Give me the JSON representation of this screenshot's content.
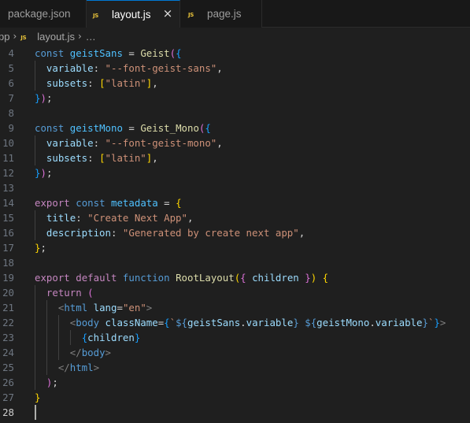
{
  "tabs": [
    {
      "label": "package.json",
      "active": false,
      "icon": "json-file-icon"
    },
    {
      "label": "layout.js",
      "active": true,
      "icon": "js-file-icon",
      "close": "×"
    },
    {
      "label": "page.js",
      "active": false,
      "icon": "js-file-icon"
    }
  ],
  "js_icon_text": "JS",
  "breadcrumb": {
    "folder": "pp",
    "file": "layout.js",
    "more": "…",
    "sep": "›"
  },
  "editor": {
    "current_line": "28",
    "lines": [
      {
        "n": "4",
        "tokens": [
          [
            "kw",
            "const"
          ],
          [
            "pn",
            " "
          ],
          [
            "const",
            "geistSans"
          ],
          [
            "pn",
            " = "
          ],
          [
            "fn",
            "Geist"
          ],
          [
            "p2",
            "("
          ],
          [
            "p3",
            "{"
          ]
        ]
      },
      {
        "n": "5",
        "tokens": [
          [
            "pn",
            "  "
          ],
          [
            "var",
            "variable"
          ],
          [
            "pn",
            ": "
          ],
          [
            "str",
            "\"--font-geist-sans\""
          ],
          [
            "pn",
            ","
          ]
        ]
      },
      {
        "n": "6",
        "tokens": [
          [
            "pn",
            "  "
          ],
          [
            "var",
            "subsets"
          ],
          [
            "pn",
            ": "
          ],
          [
            "p1",
            "["
          ],
          [
            "str",
            "\"latin\""
          ],
          [
            "p1",
            "]"
          ],
          [
            "pn",
            ","
          ]
        ]
      },
      {
        "n": "7",
        "tokens": [
          [
            "p3",
            "}"
          ],
          [
            "p2",
            ")"
          ],
          [
            "pn",
            ";"
          ]
        ]
      },
      {
        "n": "8",
        "tokens": []
      },
      {
        "n": "9",
        "tokens": [
          [
            "kw",
            "const"
          ],
          [
            "pn",
            " "
          ],
          [
            "const",
            "geistMono"
          ],
          [
            "pn",
            " = "
          ],
          [
            "fn",
            "Geist_Mono"
          ],
          [
            "p2",
            "("
          ],
          [
            "p3",
            "{"
          ]
        ]
      },
      {
        "n": "10",
        "tokens": [
          [
            "pn",
            "  "
          ],
          [
            "var",
            "variable"
          ],
          [
            "pn",
            ": "
          ],
          [
            "str",
            "\"--font-geist-mono\""
          ],
          [
            "pn",
            ","
          ]
        ]
      },
      {
        "n": "11",
        "tokens": [
          [
            "pn",
            "  "
          ],
          [
            "var",
            "subsets"
          ],
          [
            "pn",
            ": "
          ],
          [
            "p1",
            "["
          ],
          [
            "str",
            "\"latin\""
          ],
          [
            "p1",
            "]"
          ],
          [
            "pn",
            ","
          ]
        ]
      },
      {
        "n": "12",
        "tokens": [
          [
            "p3",
            "}"
          ],
          [
            "p2",
            ")"
          ],
          [
            "pn",
            ";"
          ]
        ]
      },
      {
        "n": "13",
        "tokens": []
      },
      {
        "n": "14",
        "tokens": [
          [
            "kw2",
            "export"
          ],
          [
            "pn",
            " "
          ],
          [
            "kw",
            "const"
          ],
          [
            "pn",
            " "
          ],
          [
            "const",
            "metadata"
          ],
          [
            "pn",
            " = "
          ],
          [
            "p1",
            "{"
          ]
        ]
      },
      {
        "n": "15",
        "tokens": [
          [
            "pn",
            "  "
          ],
          [
            "var",
            "title"
          ],
          [
            "pn",
            ": "
          ],
          [
            "str",
            "\"Create Next App\""
          ],
          [
            "pn",
            ","
          ]
        ]
      },
      {
        "n": "16",
        "tokens": [
          [
            "pn",
            "  "
          ],
          [
            "var",
            "description"
          ],
          [
            "pn",
            ": "
          ],
          [
            "str",
            "\"Generated by create next app\""
          ],
          [
            "pn",
            ","
          ]
        ]
      },
      {
        "n": "17",
        "tokens": [
          [
            "p1",
            "}"
          ],
          [
            "pn",
            ";"
          ]
        ]
      },
      {
        "n": "18",
        "tokens": []
      },
      {
        "n": "19",
        "tokens": [
          [
            "kw2",
            "export"
          ],
          [
            "pn",
            " "
          ],
          [
            "kw2",
            "default"
          ],
          [
            "pn",
            " "
          ],
          [
            "kw",
            "function"
          ],
          [
            "pn",
            " "
          ],
          [
            "fn",
            "RootLayout"
          ],
          [
            "p1",
            "("
          ],
          [
            "p2",
            "{"
          ],
          [
            "pn",
            " "
          ],
          [
            "var",
            "children"
          ],
          [
            "pn",
            " "
          ],
          [
            "p2",
            "}"
          ],
          [
            "p1",
            ")"
          ],
          [
            "pn",
            " "
          ],
          [
            "p1",
            "{"
          ]
        ]
      },
      {
        "n": "20",
        "tokens": [
          [
            "pn",
            "  "
          ],
          [
            "kw2",
            "return"
          ],
          [
            "pn",
            " "
          ],
          [
            "p2",
            "("
          ]
        ]
      },
      {
        "n": "21",
        "tokens": [
          [
            "pn",
            "    "
          ],
          [
            "brk",
            "<"
          ],
          [
            "tag",
            "html"
          ],
          [
            "pn",
            " "
          ],
          [
            "attr",
            "lang"
          ],
          [
            "pn",
            "="
          ],
          [
            "str",
            "\"en\""
          ],
          [
            "brk",
            ">"
          ]
        ]
      },
      {
        "n": "22",
        "tokens": [
          [
            "pn",
            "      "
          ],
          [
            "brk",
            "<"
          ],
          [
            "tag",
            "body"
          ],
          [
            "pn",
            " "
          ],
          [
            "attr",
            "className"
          ],
          [
            "pn",
            "="
          ],
          [
            "p3",
            "{"
          ],
          [
            "str",
            "`"
          ],
          [
            "kw",
            "${"
          ],
          [
            "var",
            "geistSans"
          ],
          [
            "pn",
            "."
          ],
          [
            "var",
            "variable"
          ],
          [
            "kw",
            "}"
          ],
          [
            "str",
            " "
          ],
          [
            "kw",
            "${"
          ],
          [
            "var",
            "geistMono"
          ],
          [
            "pn",
            "."
          ],
          [
            "var",
            "variable"
          ],
          [
            "kw",
            "}"
          ],
          [
            "str",
            "`"
          ],
          [
            "p3",
            "}"
          ],
          [
            "brk",
            ">"
          ]
        ]
      },
      {
        "n": "23",
        "tokens": [
          [
            "pn",
            "        "
          ],
          [
            "p3",
            "{"
          ],
          [
            "var",
            "children"
          ],
          [
            "p3",
            "}"
          ]
        ]
      },
      {
        "n": "24",
        "tokens": [
          [
            "pn",
            "      "
          ],
          [
            "brk",
            "</"
          ],
          [
            "tag",
            "body"
          ],
          [
            "brk",
            ">"
          ]
        ]
      },
      {
        "n": "25",
        "tokens": [
          [
            "pn",
            "    "
          ],
          [
            "brk",
            "</"
          ],
          [
            "tag",
            "html"
          ],
          [
            "brk",
            ">"
          ]
        ]
      },
      {
        "n": "26",
        "tokens": [
          [
            "pn",
            "  "
          ],
          [
            "p2",
            ")"
          ],
          [
            "pn",
            ";"
          ]
        ]
      },
      {
        "n": "27",
        "tokens": [
          [
            "p1",
            "}"
          ]
        ]
      },
      {
        "n": "28",
        "tokens": []
      }
    ]
  }
}
